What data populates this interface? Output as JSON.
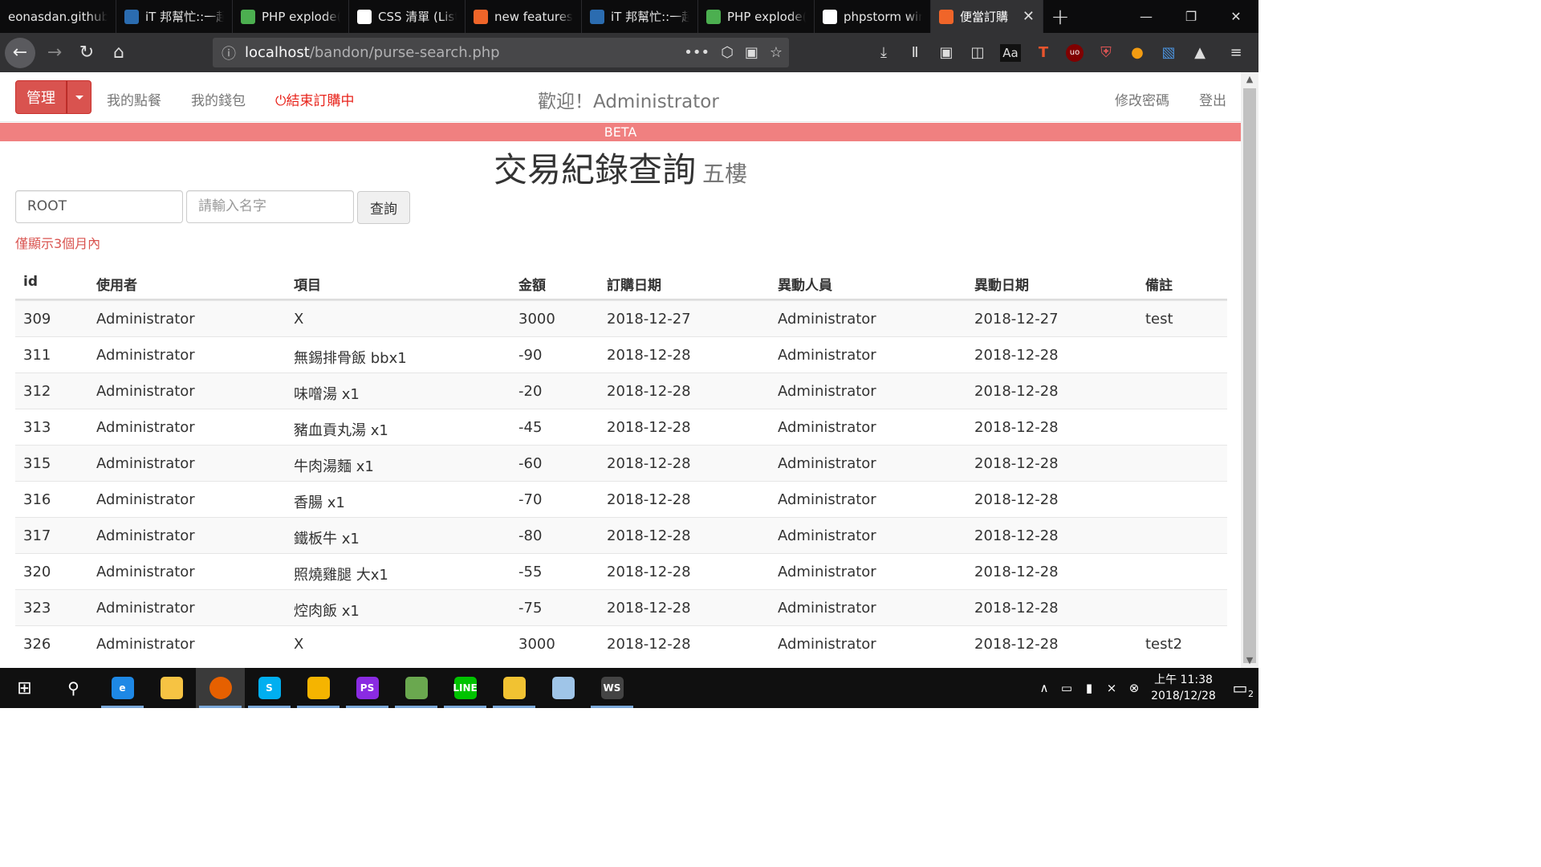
{
  "browser": {
    "tabs": [
      {
        "title": "eonasdan.github",
        "icon": "none",
        "color": "#0c0c0d"
      },
      {
        "title": "iT 邦幫忙::一起",
        "icon": "ithome-icon",
        "color": "#2b6cb0"
      },
      {
        "title": "PHP explode(",
        "icon": "w3-icon",
        "color": "#4caf50"
      },
      {
        "title": "CSS 清單 (List",
        "icon": "1kd-icon",
        "color": "#ffffff"
      },
      {
        "title": "new features",
        "icon": "bandon-icon",
        "color": "#f06529"
      },
      {
        "title": "iT 邦幫忙::一起",
        "icon": "ithome-icon",
        "color": "#2b6cb0"
      },
      {
        "title": "PHP explode(",
        "icon": "w3-icon",
        "color": "#4caf50"
      },
      {
        "title": "phpstorm win",
        "icon": "google-icon",
        "color": "#ffffff"
      },
      {
        "title": "便當訂購",
        "icon": "bandon-icon",
        "color": "#f06529"
      }
    ],
    "url_host": "localhost",
    "url_path": "/bandon/purse-search.php"
  },
  "nav": {
    "manage_label": "管理",
    "links": [
      "我的點餐",
      "我的錢包"
    ],
    "stop_label": "結束訂購中",
    "welcome": "歡迎！Administrator",
    "change_password": "修改密碼",
    "logout": "登出"
  },
  "beta_label": "BETA",
  "page": {
    "title": "交易紀錄查詢",
    "subtitle": "五樓",
    "notice": "僅顯示3個月內"
  },
  "search": {
    "group_value": "ROOT",
    "name_placeholder": "請輸入名字",
    "button_label": "查詢"
  },
  "table": {
    "headers": [
      "id",
      "使用者",
      "項目",
      "金額",
      "訂購日期",
      "異動人員",
      "異動日期",
      "備註"
    ],
    "rows": [
      [
        "309",
        "Administrator",
        "X",
        "3000",
        "2018-12-27",
        "Administrator",
        "2018-12-27",
        "test"
      ],
      [
        "311",
        "Administrator",
        "無錫排骨飯 bbx1",
        "-90",
        "2018-12-28",
        "Administrator",
        "2018-12-28",
        ""
      ],
      [
        "312",
        "Administrator",
        "味噌湯 x1",
        "-20",
        "2018-12-28",
        "Administrator",
        "2018-12-28",
        ""
      ],
      [
        "313",
        "Administrator",
        "豬血貢丸湯 x1",
        "-45",
        "2018-12-28",
        "Administrator",
        "2018-12-28",
        ""
      ],
      [
        "315",
        "Administrator",
        "牛肉湯麵 x1",
        "-60",
        "2018-12-28",
        "Administrator",
        "2018-12-28",
        ""
      ],
      [
        "316",
        "Administrator",
        "香腸 x1",
        "-70",
        "2018-12-28",
        "Administrator",
        "2018-12-28",
        ""
      ],
      [
        "317",
        "Administrator",
        "鐵板牛 x1",
        "-80",
        "2018-12-28",
        "Administrator",
        "2018-12-28",
        ""
      ],
      [
        "320",
        "Administrator",
        "照燒雞腿 大x1",
        "-55",
        "2018-12-28",
        "Administrator",
        "2018-12-28",
        ""
      ],
      [
        "323",
        "Administrator",
        "焢肉飯 x1",
        "-75",
        "2018-12-28",
        "Administrator",
        "2018-12-28",
        ""
      ],
      [
        "326",
        "Administrator",
        "X",
        "3000",
        "2018-12-28",
        "Administrator",
        "2018-12-28",
        "test2"
      ]
    ]
  },
  "taskbar": {
    "clock_time": "上午 11:38",
    "clock_date": "2018/12/28",
    "notification_count": "2",
    "apps": [
      {
        "name": "ie-icon",
        "color": "#1e88e5",
        "label": "e"
      },
      {
        "name": "file-explorer-icon",
        "color": "#f6c343",
        "label": ""
      },
      {
        "name": "firefox-icon",
        "color": "#e66000",
        "label": ""
      },
      {
        "name": "skype-icon",
        "color": "#00aff0",
        "label": "S"
      },
      {
        "name": "mail-icon",
        "color": "#f5b400",
        "label": ""
      },
      {
        "name": "phpstorm-icon",
        "color": "#8a2be2",
        "label": "PS"
      },
      {
        "name": "notepad-icon",
        "color": "#6aa84f",
        "label": ""
      },
      {
        "name": "line-icon",
        "color": "#00c300",
        "label": "LINE"
      },
      {
        "name": "db-tools-icon",
        "color": "#f1c232",
        "label": ""
      },
      {
        "name": "paint-icon",
        "color": "#9fc5e8",
        "label": ""
      },
      {
        "name": "webstorm-icon",
        "color": "#444444",
        "label": "WS"
      }
    ]
  },
  "colors": {
    "danger": "#d9534f",
    "beta_bar": "#f08080",
    "stop_link": "#e8231b"
  }
}
